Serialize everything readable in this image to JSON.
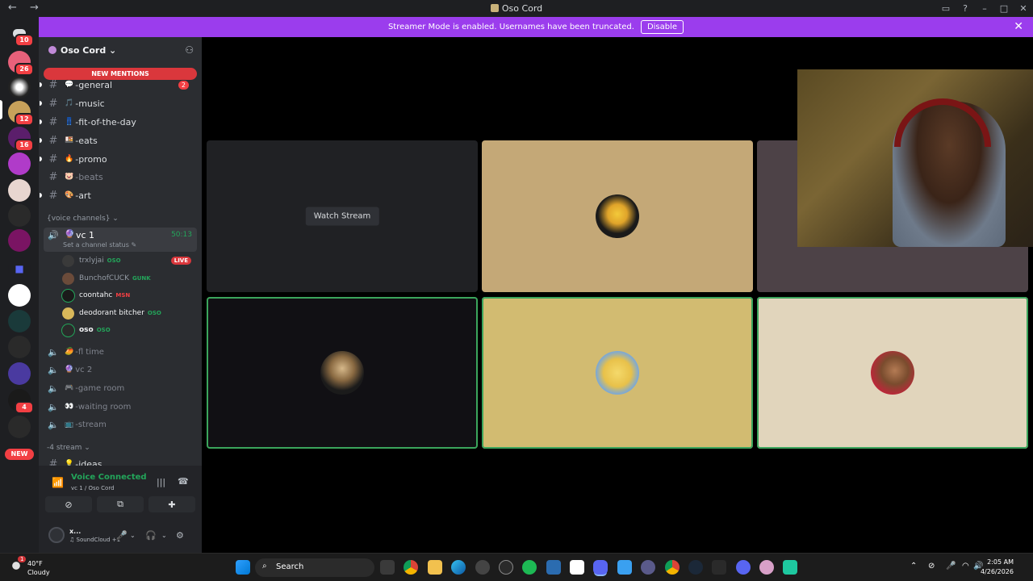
{
  "window": {
    "title": "Oso Cord",
    "nav": "← →"
  },
  "banner": {
    "text": "Streamer Mode is enabled. Usernames have been truncated.",
    "disable_label": "Disable"
  },
  "servers": [
    {
      "badge": "10"
    },
    {
      "badge": "26"
    },
    {
      "badge": ""
    },
    {
      "badge": "12"
    },
    {
      "badge": "16"
    },
    {
      "badge": ""
    },
    {
      "badge": ""
    },
    {
      "badge": ""
    },
    {
      "badge": ""
    },
    {
      "badge": ""
    },
    {
      "badge": ""
    },
    {
      "badge": ""
    },
    {
      "badge": ""
    },
    {
      "badge": "4"
    },
    {
      "badge": ""
    },
    {
      "label": "NEW"
    }
  ],
  "guild": {
    "name": "Oso Cord ⌄"
  },
  "new_mentions": "NEW MENTIONS",
  "channels": [
    {
      "emoji": "💬",
      "name": "-general",
      "count": "2"
    },
    {
      "emoji": "🎵",
      "name": "-music"
    },
    {
      "emoji": "👖",
      "name": "-fit-of-the-day"
    },
    {
      "emoji": "🍱",
      "name": "-eats"
    },
    {
      "emoji": "🔥",
      "name": "-promo"
    },
    {
      "emoji": "🐷",
      "name": "-beats"
    },
    {
      "emoji": "🎨",
      "name": "-art"
    }
  ],
  "voice_category": "{voice channels} ⌄",
  "active_vc": {
    "emoji": "🔮",
    "name": "vc 1",
    "timer": "50:13",
    "status": "Set a channel status ✎"
  },
  "voice_users": [
    {
      "name": "trxlyjai",
      "tag": "OSO",
      "live": "LIVE"
    },
    {
      "name": "BunchofCUCK",
      "tag": "GUNK"
    },
    {
      "name": "coontahc",
      "tag": "MSN"
    },
    {
      "name": "deodorant bitcher",
      "tag": "OSO"
    },
    {
      "name": "oso",
      "tag": "OSO"
    }
  ],
  "voice_channels": [
    {
      "emoji": "🥭",
      "name": "-fl time"
    },
    {
      "emoji": "🔮",
      "name": "vc 2"
    },
    {
      "emoji": "🎮",
      "name": "-game room"
    },
    {
      "emoji": "👀",
      "name": "-waiting room"
    },
    {
      "emoji": "📺",
      "name": "-stream"
    }
  ],
  "stream_category": "-4 stream ⌄",
  "ideas_channel": {
    "emoji": "💡",
    "name": "-ideas"
  },
  "voice_panel": {
    "label": "Voice Connected",
    "sub": "vc 1 / Oso Cord"
  },
  "user": {
    "name": "x...",
    "activity": "♫ SoundCloud +1"
  },
  "stage": {
    "watch_stream": "Watch Stream"
  },
  "taskbar": {
    "temp": "40°F",
    "cond": "Cloudy",
    "weather_badge": "1",
    "search": "Search",
    "time": "2:05 AM",
    "date": "4/26/2026"
  },
  "colors": {
    "accent": "#9b3ded",
    "speaking": "#3ba55c",
    "danger": "#f23f43"
  }
}
